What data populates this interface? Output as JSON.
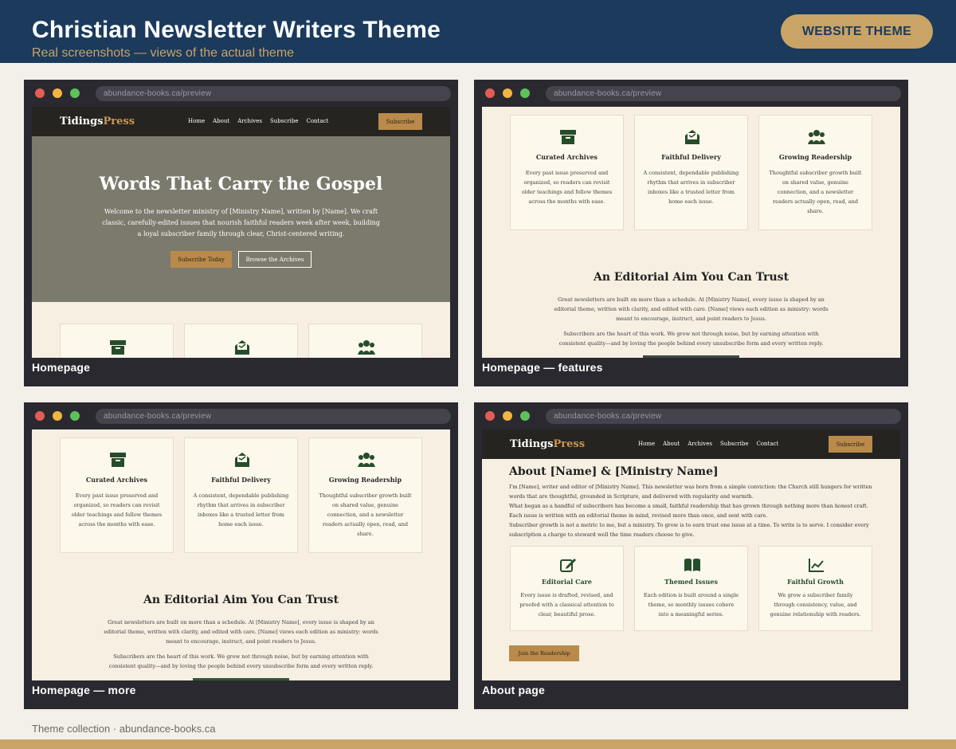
{
  "header": {
    "title": "Christian Newsletter Writers Theme",
    "subtitle": "Real screenshots — views of the actual theme",
    "badge": "WEBSITE THEME",
    "bg_color": "#1b3a5c",
    "accent_color": "#c9a466"
  },
  "browser": {
    "url": "abundance-books.ca/preview"
  },
  "site": {
    "brand_part1": "Tidings",
    "brand_part2": "Press",
    "nav": [
      "Home",
      "About",
      "Archives",
      "Subscribe",
      "Contact"
    ],
    "nav_button": "Subscribe",
    "hero_title": "Words That Carry the Gospel",
    "hero_text": "Welcome to the newsletter ministry of [Ministry Name], written by [Name]. We craft classic, carefully-edited issues that nourish faithful readers week after week, building a loyal subscriber family through clear, Christ-centered writing.",
    "hero_btn1": "Subscribe Today",
    "hero_btn2": "Browse the Archives",
    "features": [
      {
        "icon": "archive-icon",
        "title": "Curated Archives",
        "text": "Every past issue preserved and organized, so readers can revisit older teachings and follow themes across the months with ease."
      },
      {
        "icon": "envelope-open-icon",
        "title": "Faithful Delivery",
        "text": "A consistent, dependable publishing rhythm that arrives in subscriber inboxes like a trusted letter from home each issue."
      },
      {
        "icon": "users-icon",
        "title": "Growing Readership",
        "text": "Thoughtful subscriber growth built on shared value, genuine connection, and a newsletter readers actually open, read, and share."
      }
    ],
    "aim_title": "An Editorial Aim You Can Trust",
    "aim_p1": "Great newsletters are built on more than a schedule. At [Ministry Name], every issue is shaped by an editorial theme, written with clarity, and edited with care. [Name] views each edition as ministry: words meant to encourage, instruct, and point readers to Jesus.",
    "aim_p2": "Subscribers are the heart of this work. We grow not through noise, but by earning attention with consistent quality—and by loving the people behind every unsubscribe form and every written reply.",
    "about_title": "About [Name] & [Ministry Name]",
    "about_p1": "I'm [Name], writer and editor of [Ministry Name]. This newsletter was born from a simple conviction: the Church still hungers for written words that are thoughtful, grounded in Scripture, and delivered with regularity and warmth.",
    "about_p2": "What began as a handful of subscribers has become a small, faithful readership that has grown through nothing more than honest craft. Each issue is written with an editorial theme in mind, revised more than once, and sent with care.",
    "about_p3": "Subscriber growth is not a metric to me, but a ministry. To grow is to earn trust one issue at a time. To write is to serve. I consider every subscription a charge to steward well the time readers choose to give.",
    "about_features": [
      {
        "icon": "edit-icon",
        "title": "Editorial Care",
        "text": "Every issue is drafted, revised, and proofed with a classical attention to clear, beautiful prose."
      },
      {
        "icon": "book-open-icon",
        "title": "Themed Issues",
        "text": "Each edition is built around a single theme, so monthly issues cohere into a meaningful series."
      },
      {
        "icon": "chart-line-icon",
        "title": "Faithful Growth",
        "text": "We grow a subscriber family through consistency, value, and genuine relationship with readers."
      }
    ],
    "join_button": "Join the Readership"
  },
  "captions": [
    "Homepage",
    "Homepage — features",
    "Homepage — more",
    "About page"
  ],
  "footer": {
    "text": "Theme collection · abundance-books.ca"
  }
}
